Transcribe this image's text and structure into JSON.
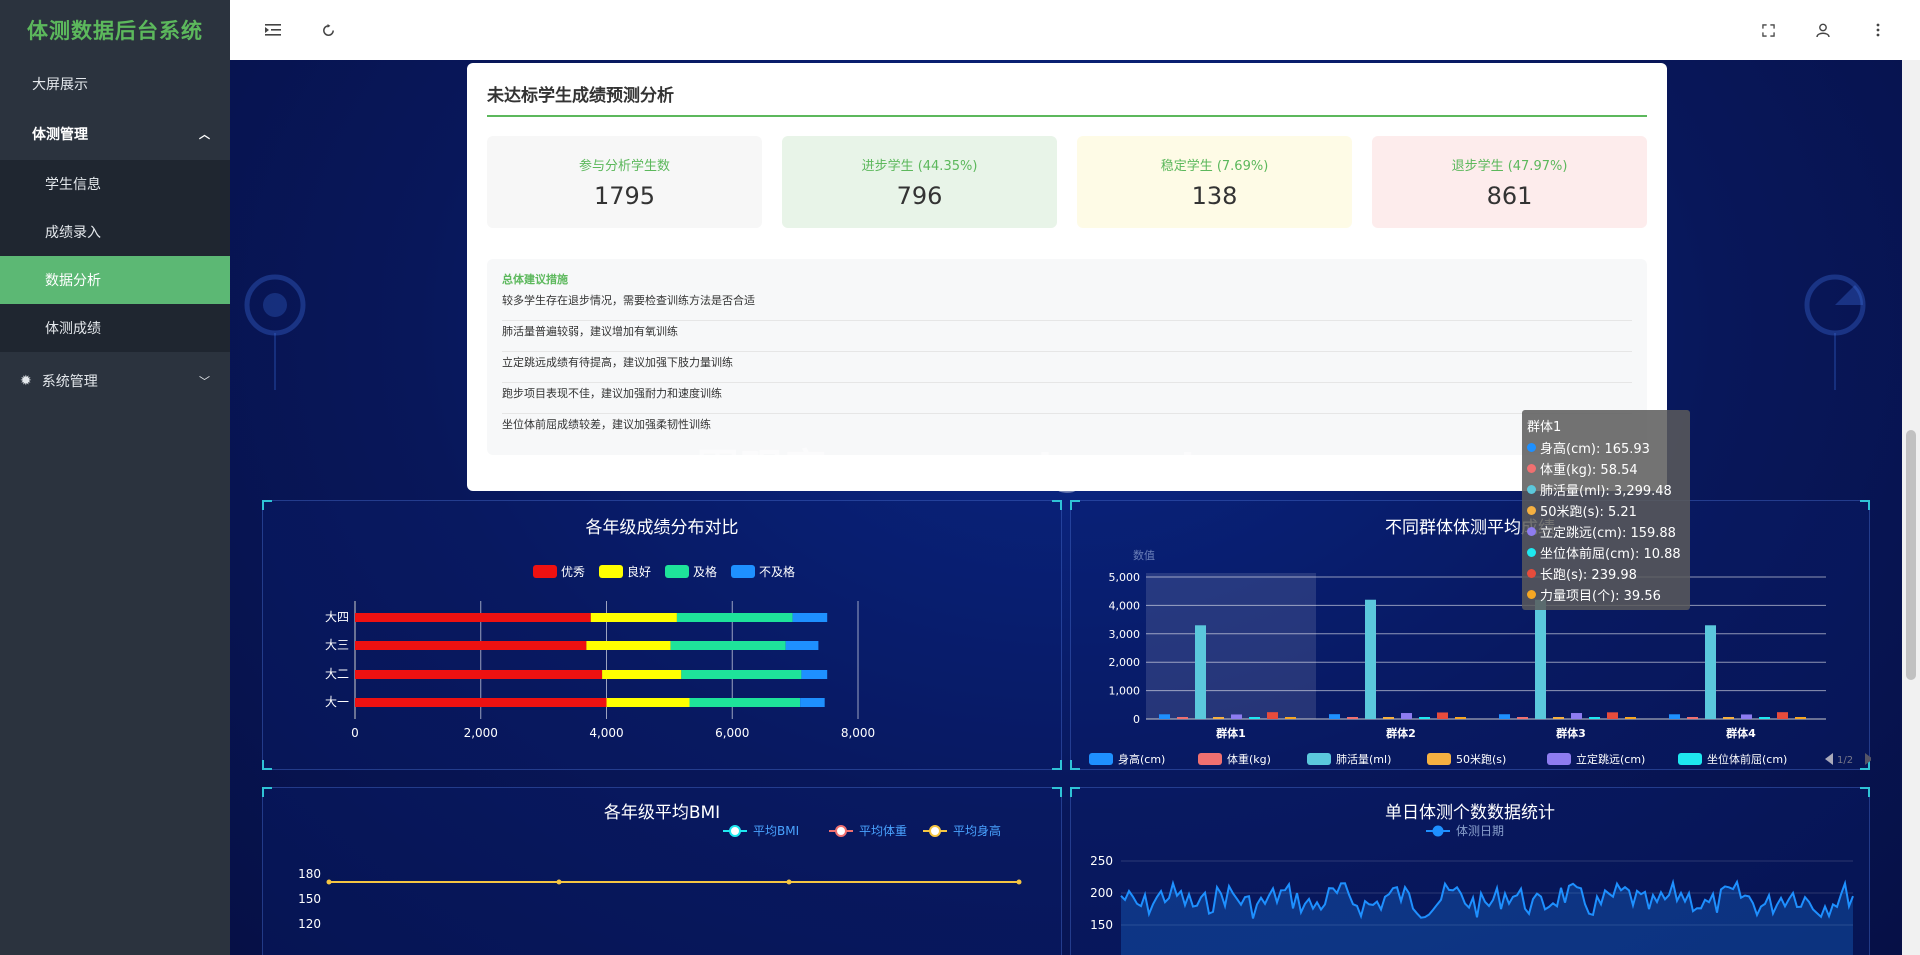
{
  "sidebar": {
    "brand": "体测数据后台系统",
    "items": {
      "bigscreen": "大屏展示",
      "group": "体测管理",
      "sub": [
        "学生信息",
        "成绩录入",
        "数据分析",
        "体测成绩"
      ],
      "system": "系统管理"
    }
  },
  "card": {
    "title": "未达标学生成绩预测分析",
    "stats": [
      {
        "label": "参与分析学生数",
        "value": "1795",
        "bg": "#f7f7f7"
      },
      {
        "label": "进步学生 (44.35%)",
        "value": "796",
        "bg": "#e8f4e8"
      },
      {
        "label": "稳定学生 (7.69%)",
        "value": "138",
        "bg": "#fefbe6"
      },
      {
        "label": "退步学生 (47.97%)",
        "value": "861",
        "bg": "#fdecec"
      }
    ],
    "advice_title": "总体建议措施",
    "advice": [
      "较多学生存在退步情况，需要检查训练方法是否合适",
      "肺活量普遍较弱，建议增加有氧训练",
      "立定跳远成绩有待提高，建议加强下肢力量训练",
      "跑步项目表现不佳，建议加强耐力和速度训练",
      "坐位体前屈成绩较差，建议加强柔韧性训练"
    ]
  },
  "panels": {
    "grade_dist": "各年级成绩分布对比",
    "group_avg": "不同群体体测平均成绩",
    "bmi": "各年级平均BMI",
    "daily": "单日体测个数数据统计"
  },
  "tooltip": {
    "title": "群体1",
    "rows": [
      {
        "label": "身高(cm): 165.93",
        "color": "#1e90ff"
      },
      {
        "label": "体重(kg): 58.54",
        "color": "#f07070"
      },
      {
        "label": "肺活量(ml): 3,299.48",
        "color": "#5bc8dc"
      },
      {
        "label": "50米跑(s): 5.21",
        "color": "#f5b041"
      },
      {
        "label": "立定跳远(cm): 159.88",
        "color": "#8e7cf0"
      },
      {
        "label": "坐位体前屈(cm): 10.88",
        "color": "#1ee8f0"
      },
      {
        "label": "长跑(s): 239.98",
        "color": "#e74c3c"
      },
      {
        "label": "力量项目(个): 39.56",
        "color": "#f5a623"
      }
    ]
  },
  "watermark": "cn围观客www.weiguanke.cn",
  "chart_data": [
    {
      "type": "bar",
      "title": "各年级成绩分布对比",
      "orientation": "horizontal-stacked",
      "categories": [
        "大一",
        "大二",
        "大三",
        "大四"
      ],
      "series": [
        {
          "name": "优秀",
          "color": "#ee1111",
          "values": [
            4000,
            3930,
            3680,
            3750
          ]
        },
        {
          "name": "良好",
          "color": "#ffff00",
          "values": [
            1320,
            1260,
            1340,
            1370
          ]
        },
        {
          "name": "及格",
          "color": "#1ee39a",
          "values": [
            1760,
            1910,
            1830,
            1840
          ]
        },
        {
          "name": "不及格",
          "color": "#1e90ff",
          "values": [
            390,
            410,
            520,
            550
          ]
        }
      ],
      "xticks": [
        "0",
        "2,000",
        "4,000",
        "6,000",
        "8,000"
      ],
      "xlim": [
        0,
        8000
      ]
    },
    {
      "type": "bar",
      "title": "不同群体体测平均成绩",
      "ylabel": "数值",
      "categories": [
        "群体1",
        "群体2",
        "群体3",
        "群体4"
      ],
      "series": [
        {
          "name": "身高(cm)",
          "color": "#1e90ff",
          "values": [
            165.93,
            170,
            168,
            166
          ]
        },
        {
          "name": "体重(kg)",
          "color": "#f07070",
          "values": [
            58.54,
            60,
            59,
            57
          ]
        },
        {
          "name": "肺活量(ml)",
          "color": "#5bc8dc",
          "values": [
            3299.48,
            4200,
            4200,
            3300
          ]
        },
        {
          "name": "50米跑(s)",
          "color": "#f5b041",
          "values": [
            5.21,
            5,
            5,
            5
          ]
        },
        {
          "name": "立定跳远(cm)",
          "color": "#8e7cf0",
          "values": [
            159.88,
            210,
            210,
            160
          ]
        },
        {
          "name": "坐位体前屈(cm)",
          "color": "#1ee8f0",
          "values": [
            10.88,
            12,
            12,
            10
          ]
        },
        {
          "name": "长跑(s)",
          "color": "#e74c3c",
          "values": [
            239.98,
            230,
            235,
            240
          ]
        },
        {
          "name": "力量项目(个)",
          "color": "#f5a623",
          "values": [
            39.56,
            40,
            40,
            38
          ]
        }
      ],
      "yticks": [
        "0",
        "1,000",
        "2,000",
        "3,000",
        "4,000",
        "5,000"
      ],
      "ylim": [
        0,
        5000
      ],
      "legend_page": "1/2"
    },
    {
      "type": "line",
      "title": "各年级平均BMI",
      "series": [
        {
          "name": "平均BMI",
          "color": "#1ee8f0"
        },
        {
          "name": "平均体重",
          "color": "#f07070"
        },
        {
          "name": "平均身高",
          "color": "#f5c542",
          "values": [
            170,
            170,
            170,
            170
          ]
        }
      ],
      "yticks": [
        "180",
        "150",
        "120"
      ]
    },
    {
      "type": "line",
      "title": "单日体测个数数据统计",
      "series": [
        {
          "name": "体测日期",
          "color": "#1e90ff"
        }
      ],
      "yticks": [
        "250",
        "200",
        "150"
      ]
    }
  ]
}
